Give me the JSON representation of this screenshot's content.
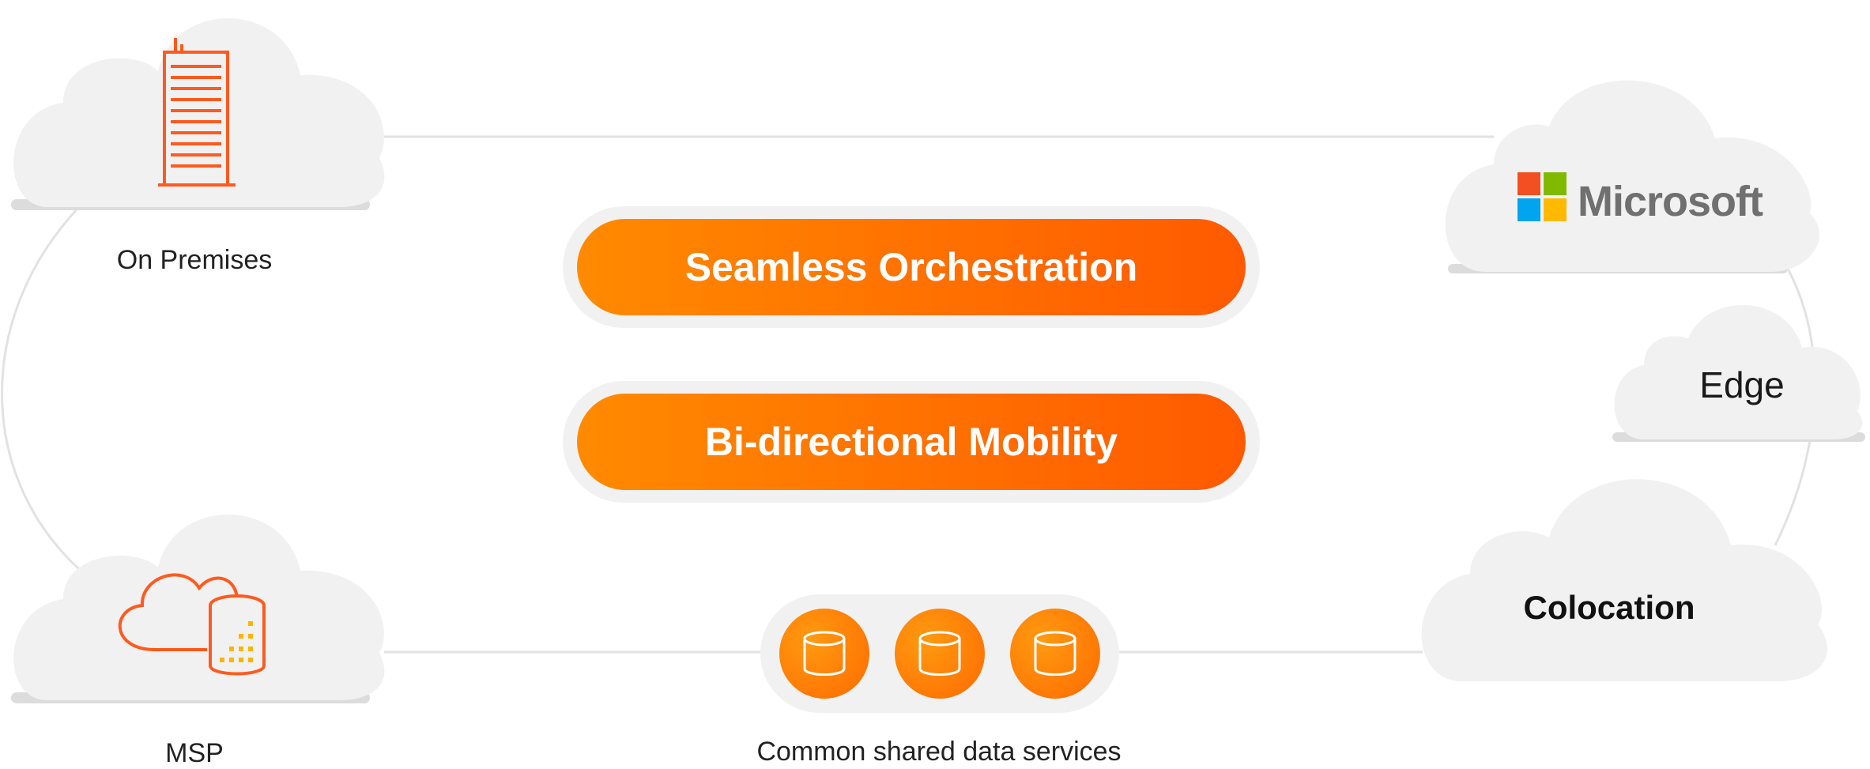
{
  "nodes": {
    "on_premises": {
      "label": "On Premises",
      "icon": "building-icon"
    },
    "msp": {
      "label": "MSP",
      "icon": "cloud-database-icon"
    },
    "microsoft": {
      "label": "Microsoft",
      "icon": "microsoft-logo"
    },
    "edge": {
      "label": "Edge"
    },
    "colocation": {
      "label": "Colocation"
    }
  },
  "capabilities": {
    "orchestration": "Seamless Orchestration",
    "mobility": "Bi-directional Mobility"
  },
  "data_services": {
    "label": "Common shared data services",
    "icons": [
      "database-icon",
      "database-icon",
      "database-icon"
    ]
  },
  "colors": {
    "accent_orange": "#ff6a00",
    "cloud_fill": "#f1f1f1",
    "connector": "#e2e2e2",
    "ms_red": "#f25022",
    "ms_green": "#7fba00",
    "ms_blue": "#00a4ef",
    "ms_yellow": "#ffb900"
  }
}
